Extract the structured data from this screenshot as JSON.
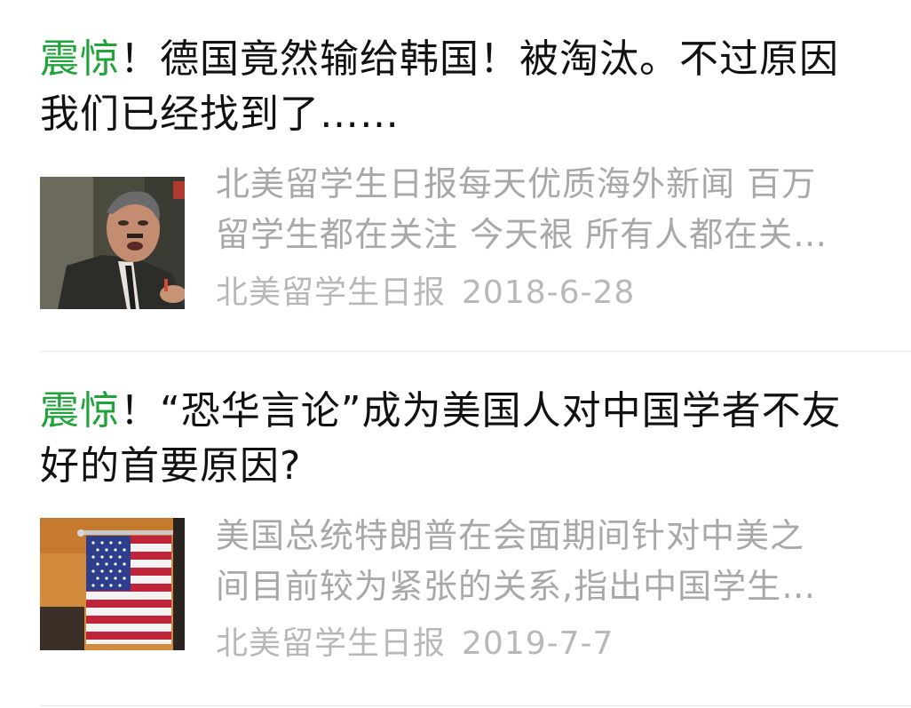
{
  "results": [
    {
      "highlight": "震惊",
      "title_rest": "！德国竟然输给韩国！被淘汰。不过原因我们已经找到了……",
      "snippet_line1": "北美留学生日报每天优质海外新闻 百万",
      "snippet_line2": "留学生都在关注 今天裉 所有人都在关…",
      "source": "北美留学生日报",
      "date": "2018-6-28",
      "thumbnail_icon": "angry-man-photo"
    },
    {
      "highlight": "震惊",
      "title_rest": "！“恐华言论”成为美国人对中国学者不友好的首要原因?",
      "snippet_line1": "美国总统特朗普在会面期间针对中美之",
      "snippet_line2": "间目前较为紧张的关系,指出中国学生…",
      "source": "北美留学生日报",
      "date": "2019-7-7",
      "thumbnail_icon": "us-flag-photo"
    }
  ],
  "colors": {
    "highlight": "#20a33a",
    "title": "#111111",
    "snippet": "#a8a8a8",
    "meta": "#b8b8b8",
    "divider": "#e6e6e6"
  }
}
